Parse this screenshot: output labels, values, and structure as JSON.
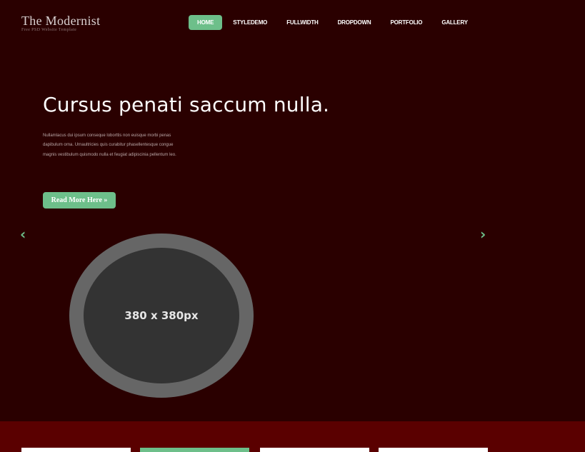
{
  "logo": {
    "title": "The Modernist",
    "tagline": "Free PSD Website Template"
  },
  "nav": {
    "items": [
      {
        "label": "HOME",
        "active": true
      },
      {
        "label": "STYLEDEMO"
      },
      {
        "label": "FULLWIDTH"
      },
      {
        "label": "DROPDOWN"
      },
      {
        "label": "PORTFOLIO"
      },
      {
        "label": "GALLERY"
      }
    ]
  },
  "hero": {
    "title": "Cursus penati saccum nulla.",
    "text": "Nullamlacus dui ipsum conseque loborttis non euisque morbi penas dapibulum orna. Urnaultricies quis curabitur phasellentesque congue magnis vestibulum quismodo nulla et feugiat adipiscinia pellentum leo.",
    "cta": "Read More Here »",
    "image_placeholder": "380 x 380px"
  },
  "slider": {
    "prev_icon": "‹",
    "next_icon": "›"
  },
  "colors": {
    "background": "#2a0000",
    "accent": "#6dbf8a",
    "band": "#5a0000"
  }
}
